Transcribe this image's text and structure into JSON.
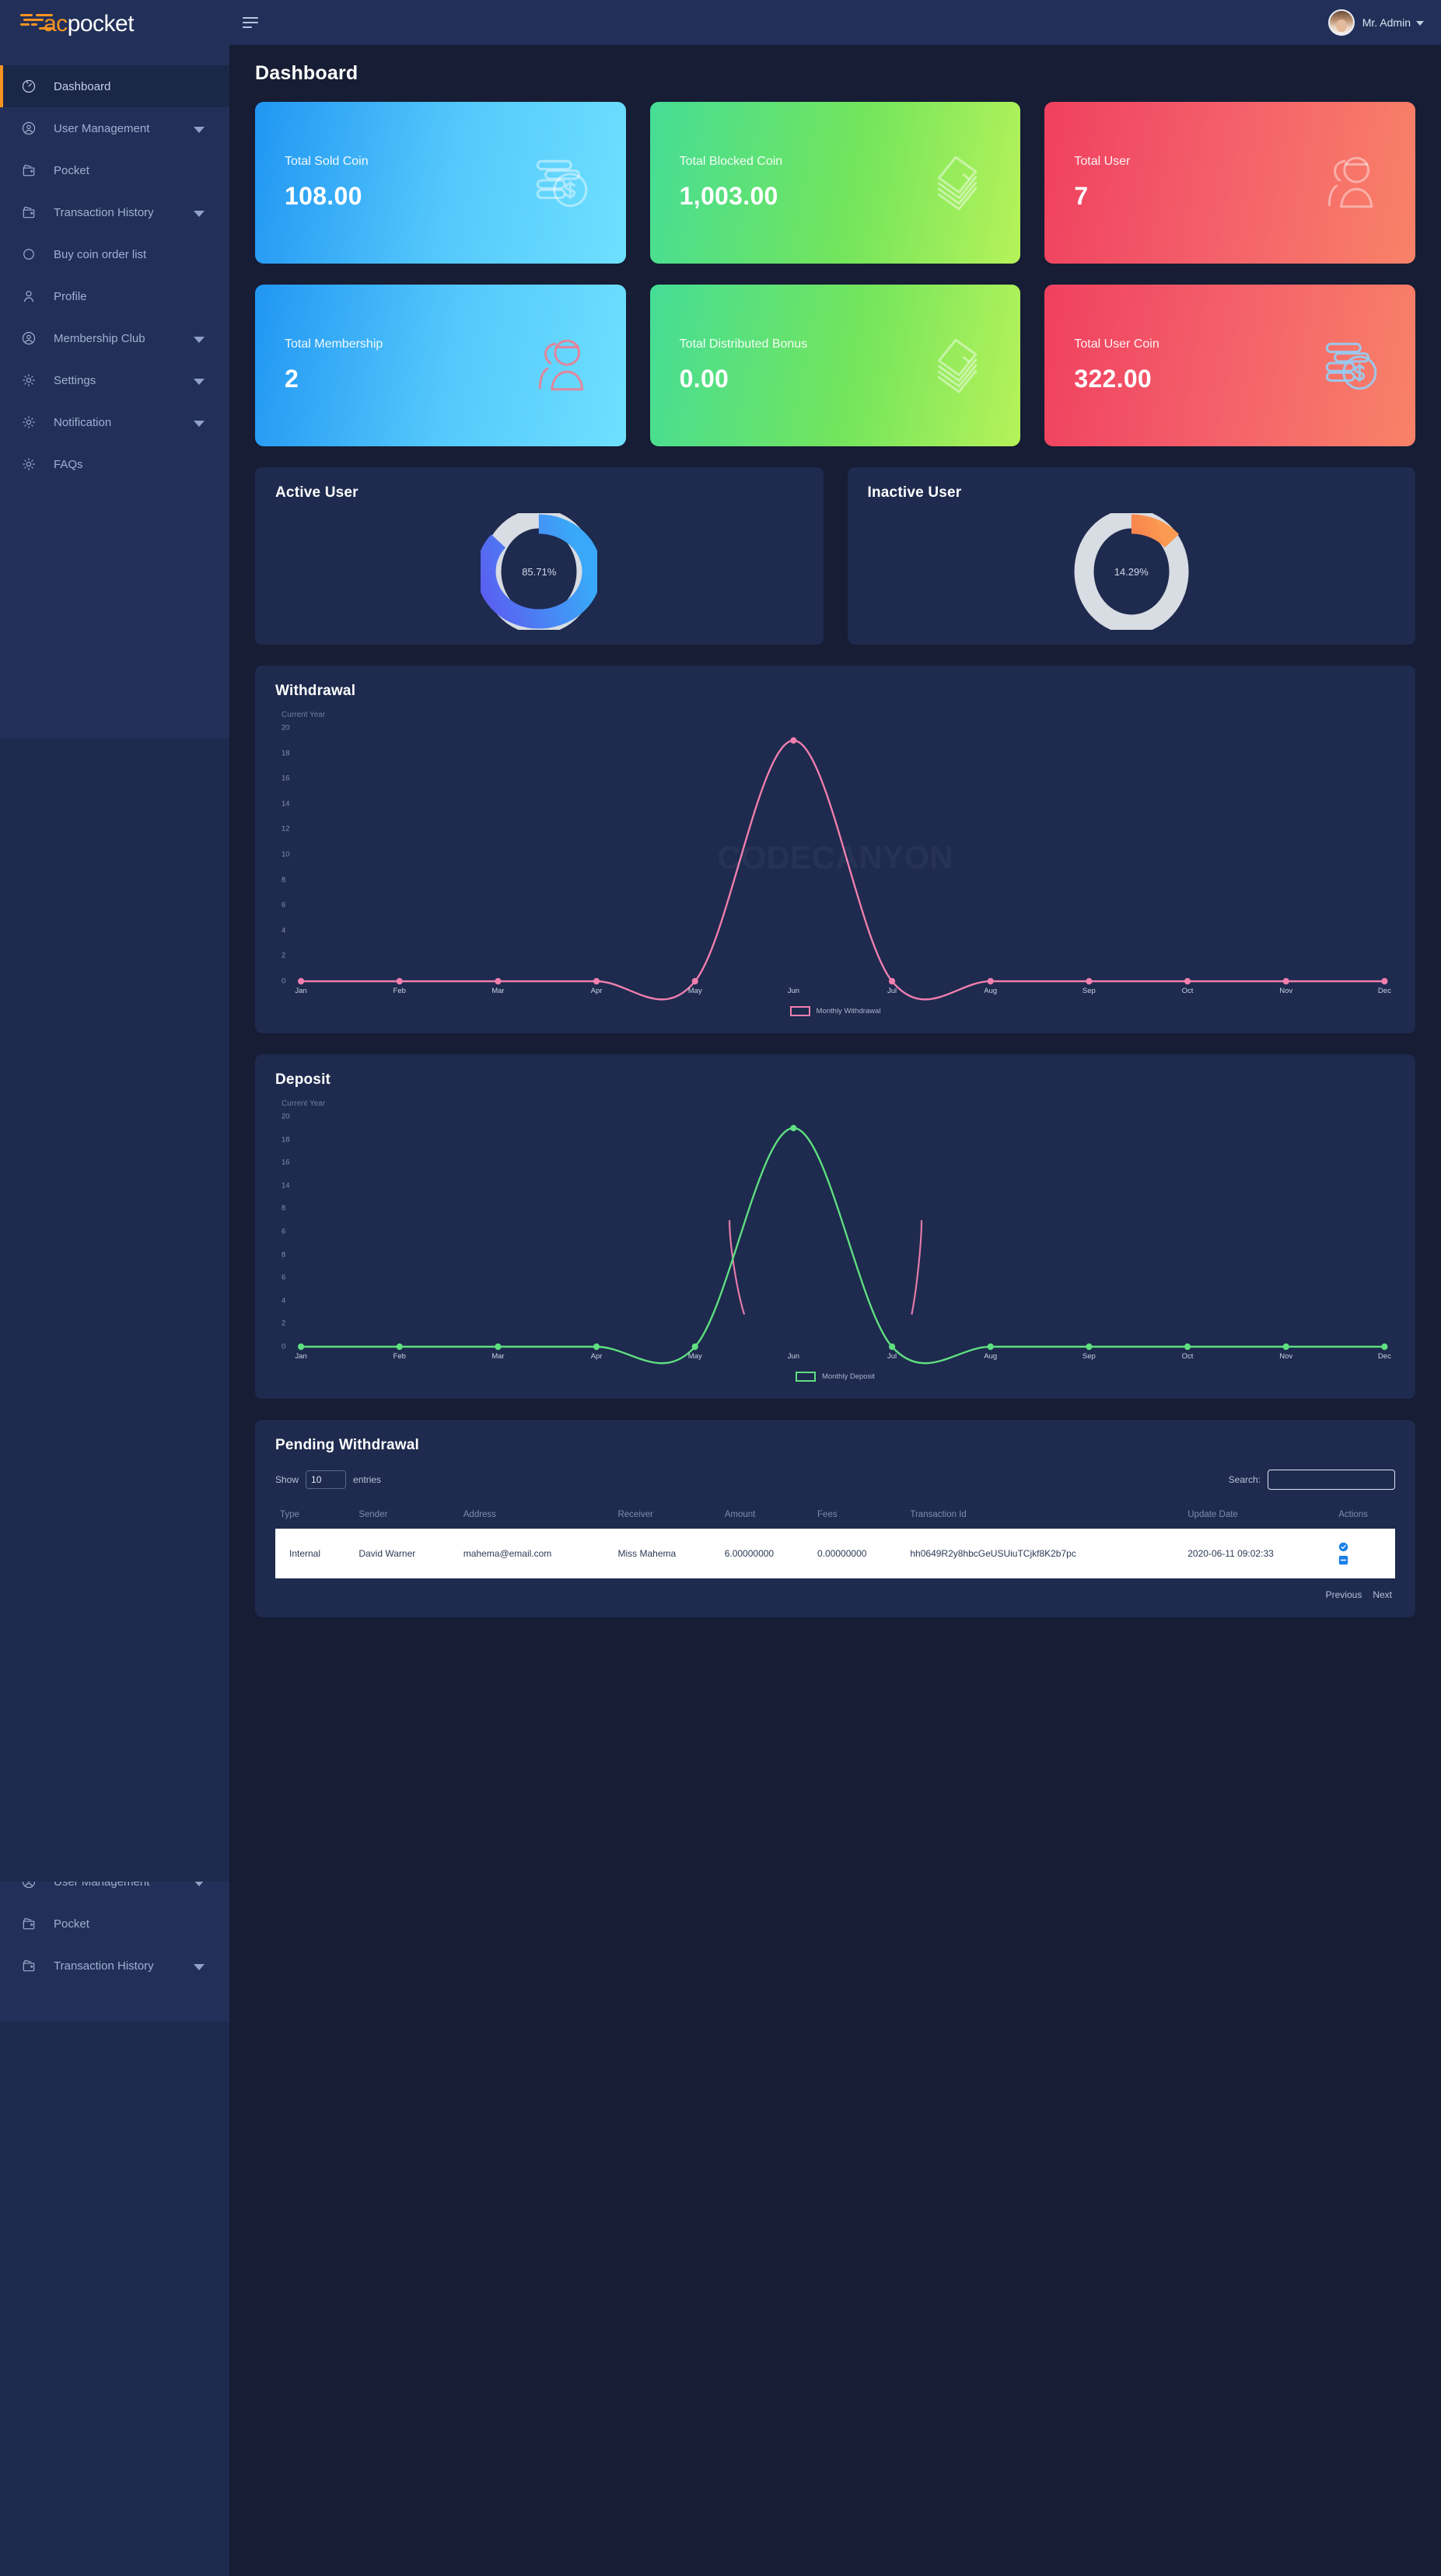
{
  "brand": {
    "prefix": "ac",
    "suffix": "pocket"
  },
  "topbar": {
    "user_name": "Mr. Admin"
  },
  "sidebar": {
    "items": [
      {
        "label": "Dashboard",
        "icon": "speedometer-icon",
        "caret": false,
        "active": true
      },
      {
        "label": "User Management",
        "icon": "user-circle-icon",
        "caret": true,
        "active": false
      },
      {
        "label": "Pocket",
        "icon": "wallet-icon",
        "caret": false,
        "active": false
      },
      {
        "label": "Transaction History",
        "icon": "wallet-icon",
        "caret": true,
        "active": false
      },
      {
        "label": "Buy coin order list",
        "icon": "circle-icon",
        "caret": false,
        "active": false
      },
      {
        "label": "Profile",
        "icon": "person-icon",
        "caret": false,
        "active": false
      },
      {
        "label": "Membership Club",
        "icon": "user-circle-icon",
        "caret": true,
        "active": false
      },
      {
        "label": "Settings",
        "icon": "gear-icon",
        "caret": true,
        "active": false
      },
      {
        "label": "Notification",
        "icon": "gear-icon",
        "caret": true,
        "active": false
      },
      {
        "label": "FAQs",
        "icon": "gear-icon",
        "caret": false,
        "active": false
      }
    ],
    "ghost_items": [
      {
        "label": "User Management",
        "icon": "user-circle-icon",
        "caret": true
      },
      {
        "label": "Pocket",
        "icon": "wallet-icon",
        "caret": false
      },
      {
        "label": "Transaction History",
        "icon": "wallet-icon",
        "caret": true
      }
    ]
  },
  "page": {
    "title": "Dashboard"
  },
  "stats": [
    {
      "label": "Total Sold Coin",
      "value": "108.00",
      "theme": "grad-blue",
      "icon": "coin-stack-dollar-icon",
      "icon_color": "rgba(255,255,255,0.45)"
    },
    {
      "label": "Total Blocked Coin",
      "value": "1,003.00",
      "theme": "grad-green",
      "icon": "money-stack-icon",
      "icon_color": "rgba(255,255,255,0.45)"
    },
    {
      "label": "Total User",
      "value": "7",
      "theme": "grad-red",
      "icon": "users-icon",
      "icon_color": "rgba(255,255,255,0.42)"
    },
    {
      "label": "Total Membership",
      "value": "2",
      "theme": "grad-blue",
      "icon": "users-icon",
      "icon_color": "rgba(245,120,140,0.85)"
    },
    {
      "label": "Total Distributed Bonus",
      "value": "0.00",
      "theme": "grad-green",
      "icon": "money-stack-icon",
      "icon_color": "rgba(255,255,255,0.45)"
    },
    {
      "label": "Total User Coin",
      "value": "322.00",
      "theme": "grad-red",
      "icon": "coin-stack-dollar-icon",
      "icon_color": "rgba(150,205,245,0.9)"
    }
  ],
  "donuts": [
    {
      "title": "Active User",
      "percent_label": "85.71%",
      "percent": 85.71,
      "fill_from": "#5b5cf0",
      "fill_to": "#3aa8f8",
      "track": "#d8dce3"
    },
    {
      "title": "Inactive User",
      "percent_label": "14.29%",
      "percent": 14.29,
      "fill_from": "#f3453f",
      "fill_to": "#fb9b52",
      "track": "#d8dce3"
    }
  ],
  "withdrawal_panel": {
    "title": "Withdrawal",
    "current_year": "Current Year"
  },
  "deposit_panel": {
    "title": "Deposit",
    "current_year": "Current Year"
  },
  "watermark": "CODECANYON",
  "chart_data": [
    {
      "type": "line",
      "title": "Withdrawal",
      "subtitle": "Current Year",
      "xlabel": "",
      "ylabel": "",
      "categories": [
        "Jan",
        "Feb",
        "Mar",
        "Apr",
        "May",
        "Jun",
        "Jul",
        "Aug",
        "Sep",
        "Oct",
        "Nov",
        "Dec"
      ],
      "series": [
        {
          "name": "Monthly Withdrawal",
          "color": "#f07fae",
          "values": [
            0,
            0,
            0,
            0,
            0,
            19,
            0,
            0,
            0,
            0,
            0,
            0
          ]
        }
      ],
      "ylim": [
        0,
        20
      ],
      "yticks": [
        0,
        2,
        4,
        6,
        8,
        10,
        12,
        14,
        16,
        18,
        20
      ],
      "grid": false,
      "legend": "bottom-center"
    },
    {
      "type": "line",
      "title": "Deposit",
      "subtitle": "Current Year",
      "xlabel": "",
      "ylabel": "",
      "categories": [
        "Jan",
        "Feb",
        "Mar",
        "Apr",
        "May",
        "Jun",
        "Jul",
        "Aug",
        "Sep",
        "Oct",
        "Nov",
        "Dec"
      ],
      "series": [
        {
          "name": "Monthly Deposit",
          "color": "#5fe080",
          "values": [
            0,
            0,
            0,
            0,
            0,
            19,
            0,
            0,
            0,
            0,
            0,
            0
          ]
        }
      ],
      "ylim": [
        0,
        20
      ],
      "yticks_labels": [
        "0",
        "2",
        "4",
        "6",
        "8",
        "6",
        "8",
        "14",
        "16",
        "18",
        "20"
      ],
      "grid": false,
      "legend": "bottom-center"
    }
  ],
  "pending_withdrawal": {
    "title": "Pending Withdrawal",
    "show_label": "Show",
    "entries_label": "entries",
    "show_value": "10",
    "search_label": "Search:",
    "search_value": "",
    "search_placeholder": "",
    "columns": [
      "Type",
      "Sender",
      "Address",
      "Receiver",
      "Amount",
      "Fees",
      "Transaction Id",
      "Update Date",
      "Actions"
    ],
    "rows": [
      {
        "type": "Internal",
        "sender": "David Warner",
        "address": "mahema@email.com",
        "receiver": "Miss Mahema",
        "amount": "6.00000000",
        "fees": "0.00000000",
        "transaction_id": "hh0649R2y8hbcGeUSUiuTCjkf8K2b7pc",
        "update_date": "2020-06-11 09:02:33",
        "actions": [
          "approve-check-icon",
          "reject-minus-icon"
        ]
      }
    ],
    "pagination": {
      "previous": "Previous",
      "next": "Next"
    }
  }
}
